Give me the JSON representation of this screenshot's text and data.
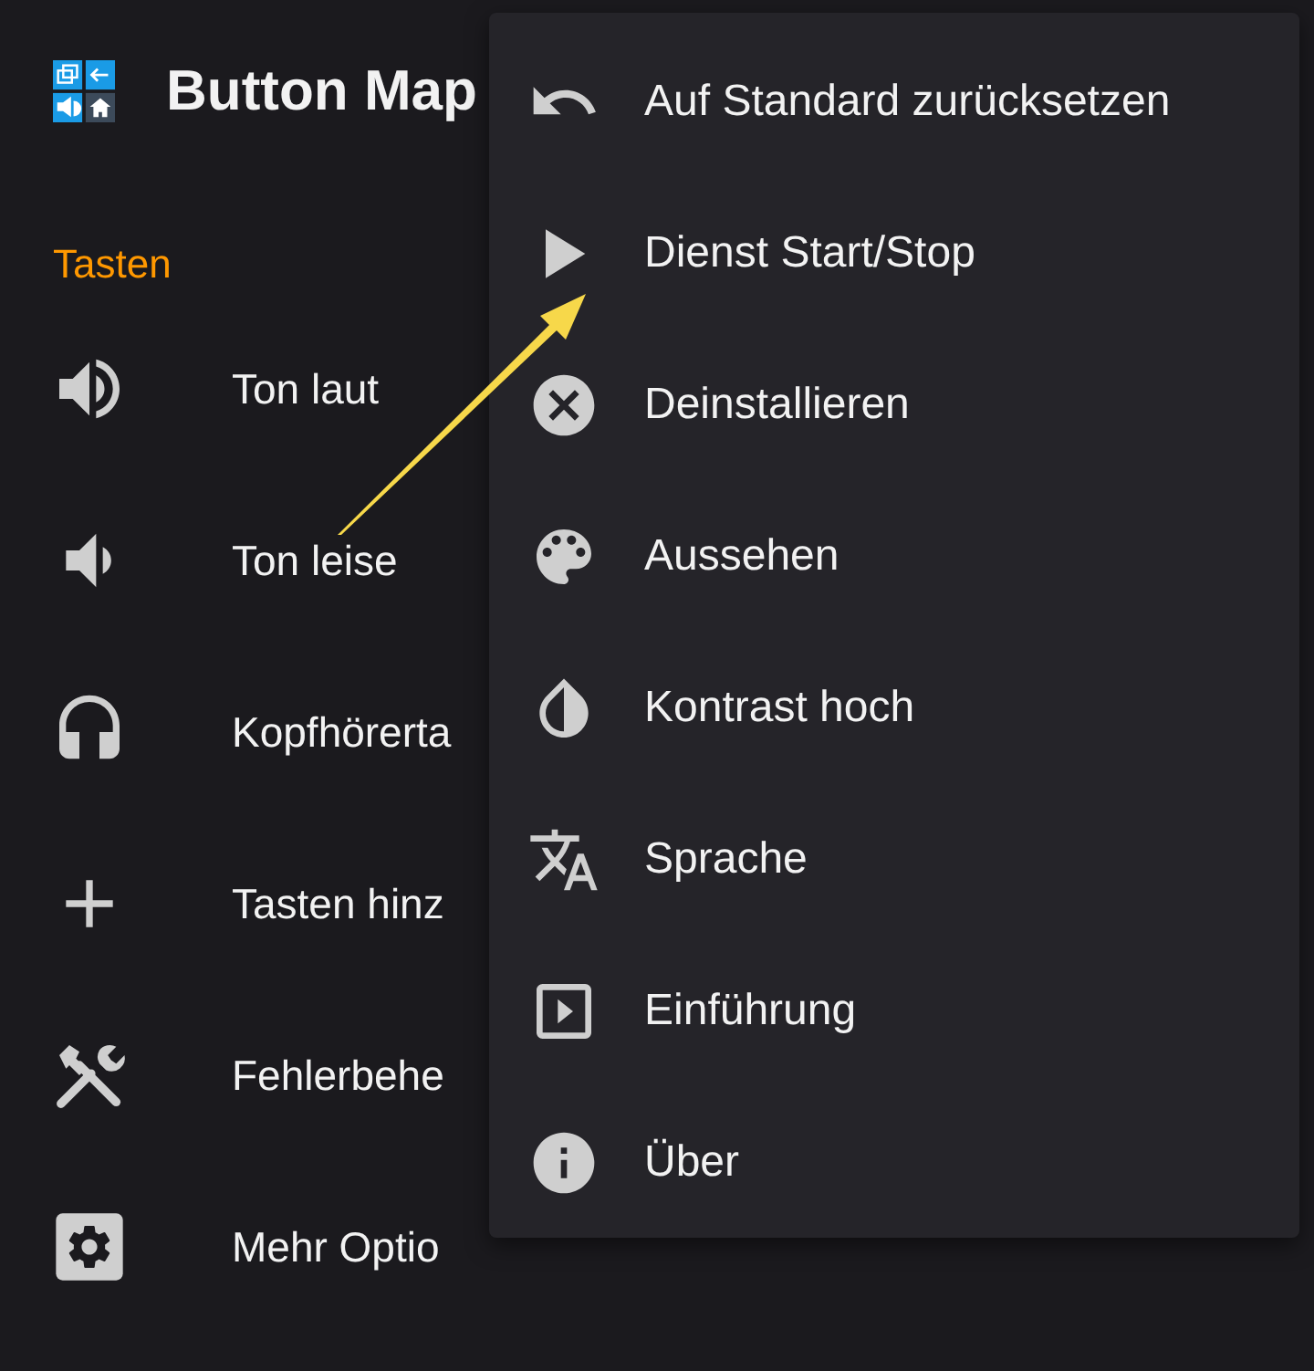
{
  "app_bar": {
    "title": "Button Map"
  },
  "section": {
    "header": "Tasten"
  },
  "items": [
    {
      "label": "Ton laut"
    },
    {
      "label": "Ton leise"
    },
    {
      "label": "Kopfhörerta"
    },
    {
      "label": "Tasten hinz"
    },
    {
      "label": "Fehlerbehe"
    },
    {
      "label": "Mehr Optio"
    }
  ],
  "menu": [
    {
      "label": "Auf Standard zurücksetzen"
    },
    {
      "label": "Dienst Start/Stop"
    },
    {
      "label": "Deinstallieren"
    },
    {
      "label": "Aussehen"
    },
    {
      "label": "Kontrast hoch"
    },
    {
      "label": "Sprache"
    },
    {
      "label": "Einführung"
    },
    {
      "label": "Über"
    }
  ]
}
